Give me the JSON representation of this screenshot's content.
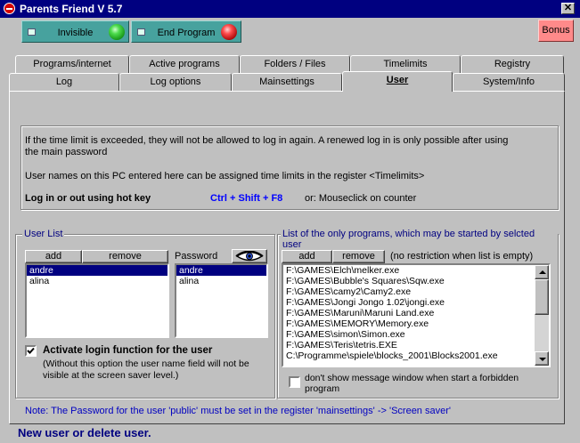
{
  "window": {
    "title": "Parents Friend V 5.7",
    "close": "✕"
  },
  "toolbar": {
    "invisible": "Invisible",
    "end_program": "End Program",
    "bonus": "Bonus"
  },
  "tabs_top": [
    "Programs/internet",
    "Active programs",
    "Folders / Files",
    "Timelimits",
    "Registry"
  ],
  "tabs_bottom": [
    "Log",
    "Log options",
    "Mainsettings",
    "User",
    "System/Info"
  ],
  "info": {
    "line1": "If the time limit is exceeded, they will not be allowed to log in again. A renewed log in is only possible after using",
    "line2": "the main password",
    "line3": "User names on this PC entered here can be assigned time limits in the register <Timelimits>",
    "hotkey_label": "Log in or out using hot key",
    "hotkey": "Ctrl + Shift + F8",
    "hotkey_or": "or: Mouseclick on counter"
  },
  "user_list": {
    "legend": "User List",
    "add": "add",
    "remove": "remove",
    "password_label": "Password",
    "users": [
      "andre",
      "alina"
    ],
    "passwords": [
      "andre",
      "alina"
    ],
    "activate_label": "Activate login function for the user",
    "activate_note1": "(Without this option the user name field will not be",
    "activate_note2": "visible at the screen saver level.)"
  },
  "programs": {
    "legend": "List of the only programs, which may be started by selcted user",
    "add": "add",
    "remove": "remove",
    "note": "(no restriction when list is empty)",
    "items": [
      "F:\\GAMES\\Elch\\melker.exe",
      "F:\\GAMES\\Bubble's Squares\\Sqw.exe",
      "F:\\GAMES\\camy2\\Camy2.exe",
      "F:\\GAMES\\Jongi Jongo 1.02\\jongi.exe",
      "F:\\GAMES\\Maruni\\Maruni Land.exe",
      "F:\\GAMES\\MEMORY\\Memory.exe",
      "F:\\GAMES\\simon\\Simon.exe",
      "F:\\GAMES\\Teris\\tetris.EXE",
      "C:\\Programme\\spiele\\blocks_2001\\Blocks2001.exe"
    ],
    "no_msg_line1": "don't show message window when start a forbidden",
    "no_msg_line2": "program"
  },
  "note": "Note: The Password for the user 'public' must be set in the register 'mainsettings' -> 'Screen saver'",
  "status": "New user or delete user."
}
